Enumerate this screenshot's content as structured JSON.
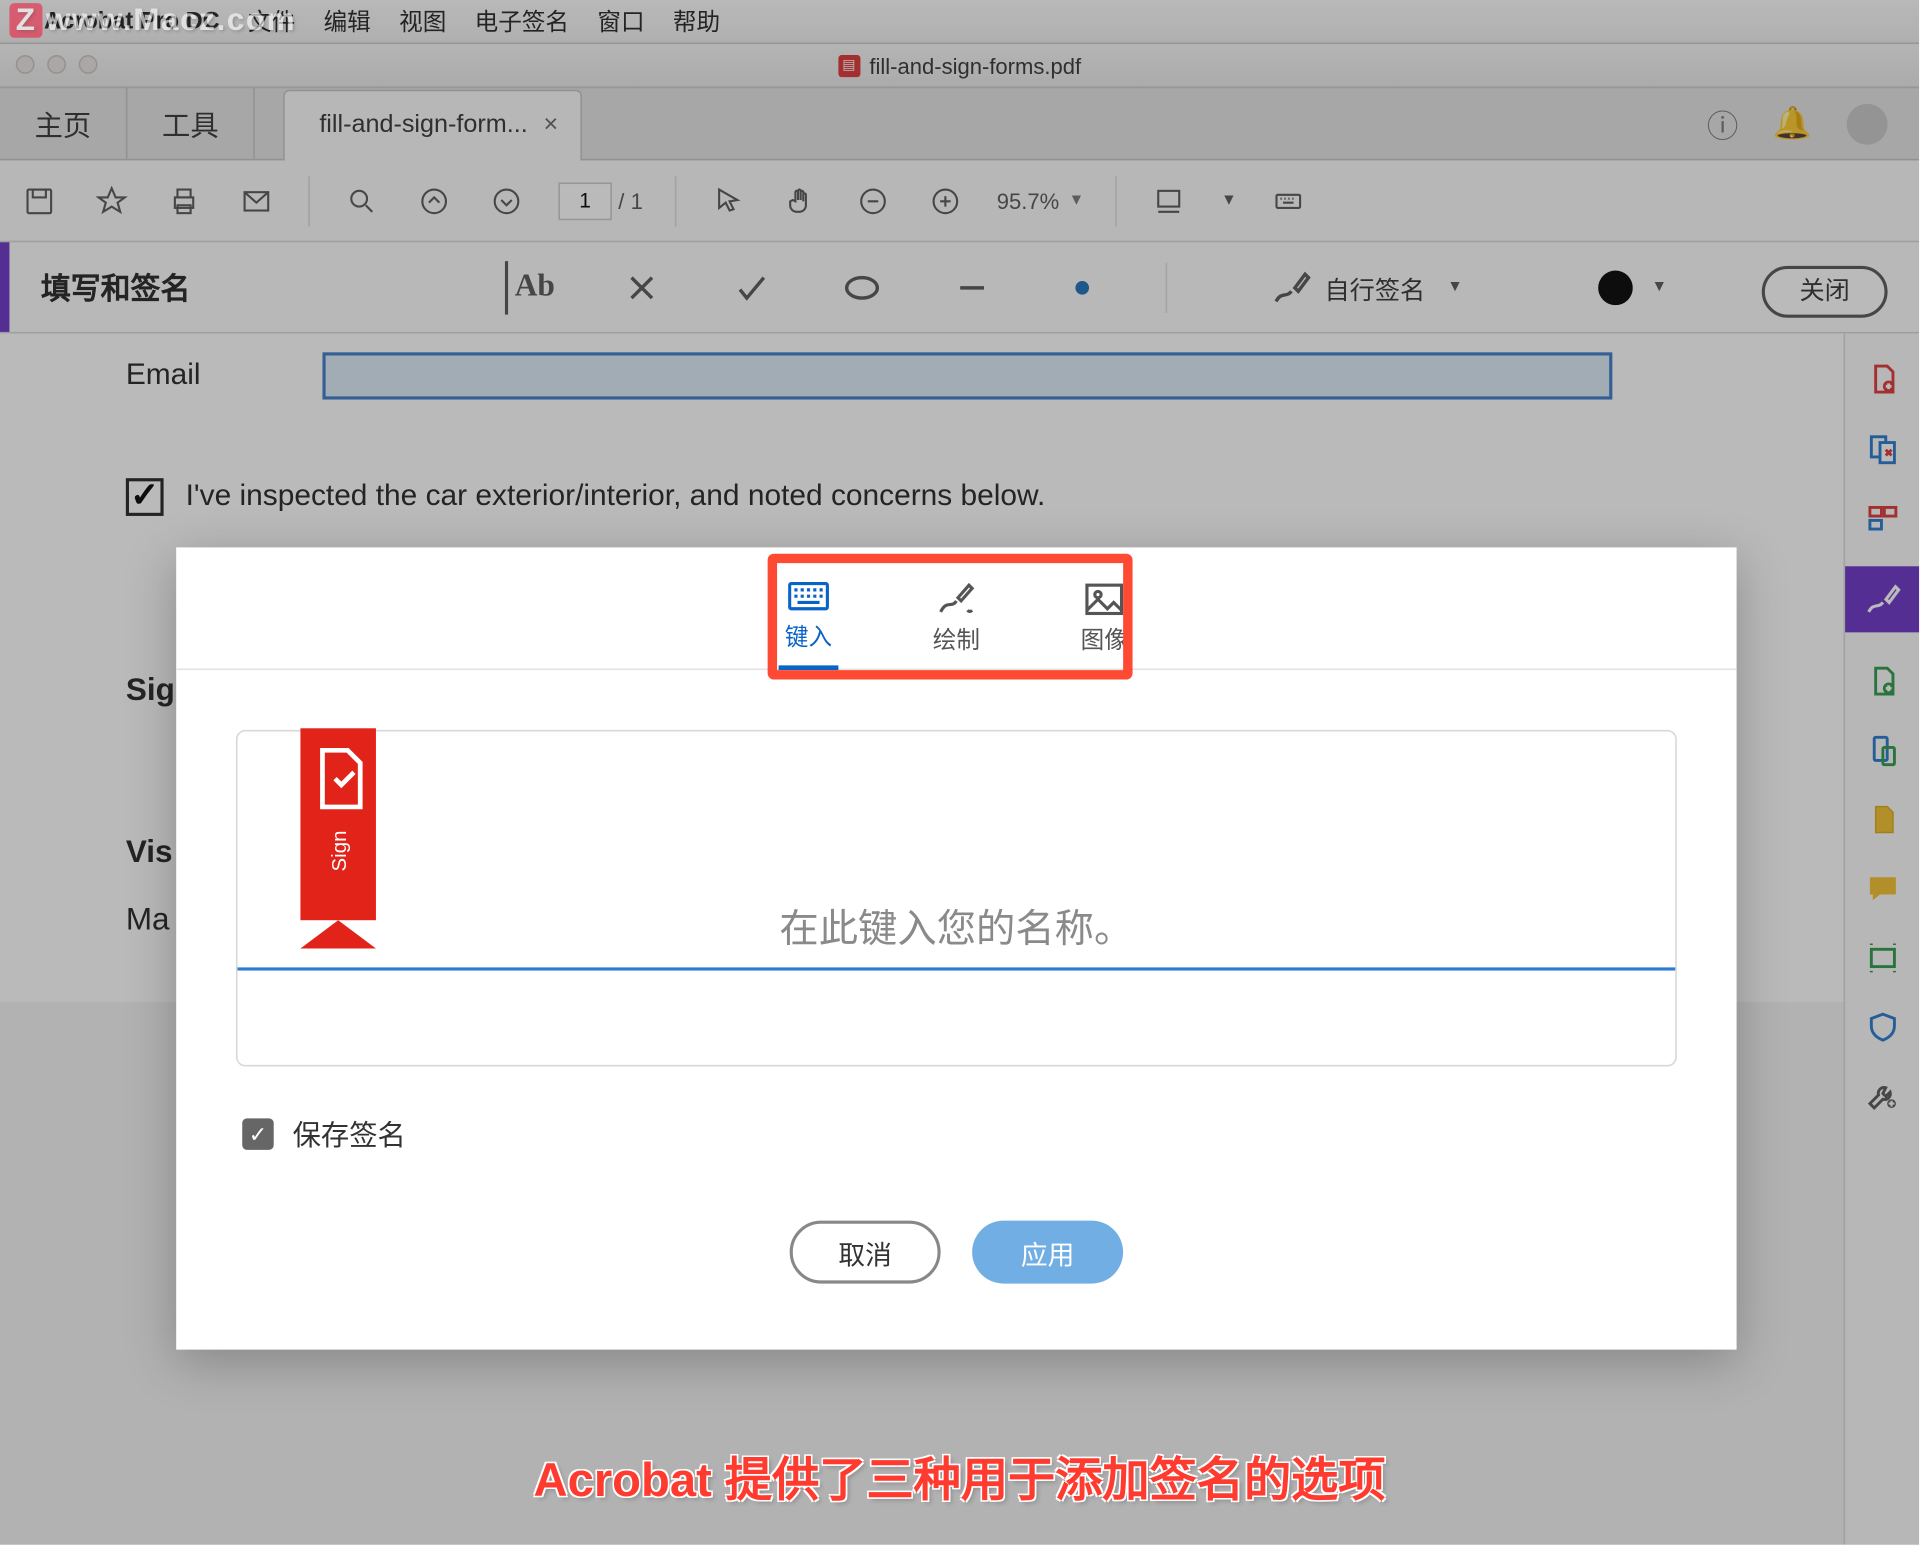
{
  "watermark": "www.Macz.com",
  "mac_menu": {
    "app": "Acrobat Pro DC",
    "items": [
      "文件",
      "编辑",
      "视图",
      "电子签名",
      "窗口",
      "帮助"
    ]
  },
  "window": {
    "title": "fill-and-sign-forms.pdf"
  },
  "tabs": {
    "home": "主页",
    "tools": "工具",
    "doc": "fill-and-sign-form..."
  },
  "toolbar": {
    "page_current": "1",
    "page_total": "1",
    "zoom": "95.7%"
  },
  "fillsign": {
    "title": "填写和签名",
    "self_sign": "自行签名",
    "close": "关闭"
  },
  "form": {
    "email_label": "Email",
    "checkbox_text": "I've inspected the car exterior/interior, and noted concerns below.",
    "sig_label": "Sig",
    "vis_label": "Vis",
    "ma_label": "Ma"
  },
  "dialog": {
    "tabs": {
      "type": "键入",
      "draw": "绘制",
      "image": "图像"
    },
    "ribbon": "Sign",
    "placeholder": "在此键入您的名称。",
    "save": "保存签名",
    "cancel": "取消",
    "apply": "应用"
  },
  "right_rail_icons": [
    "create-pdf",
    "export-pdf",
    "organize",
    "fill-sign",
    "add-page",
    "mobile",
    "file",
    "comment",
    "print",
    "protect",
    "tools"
  ],
  "caption": "Acrobat 提供了三种用于添加签名的选项"
}
